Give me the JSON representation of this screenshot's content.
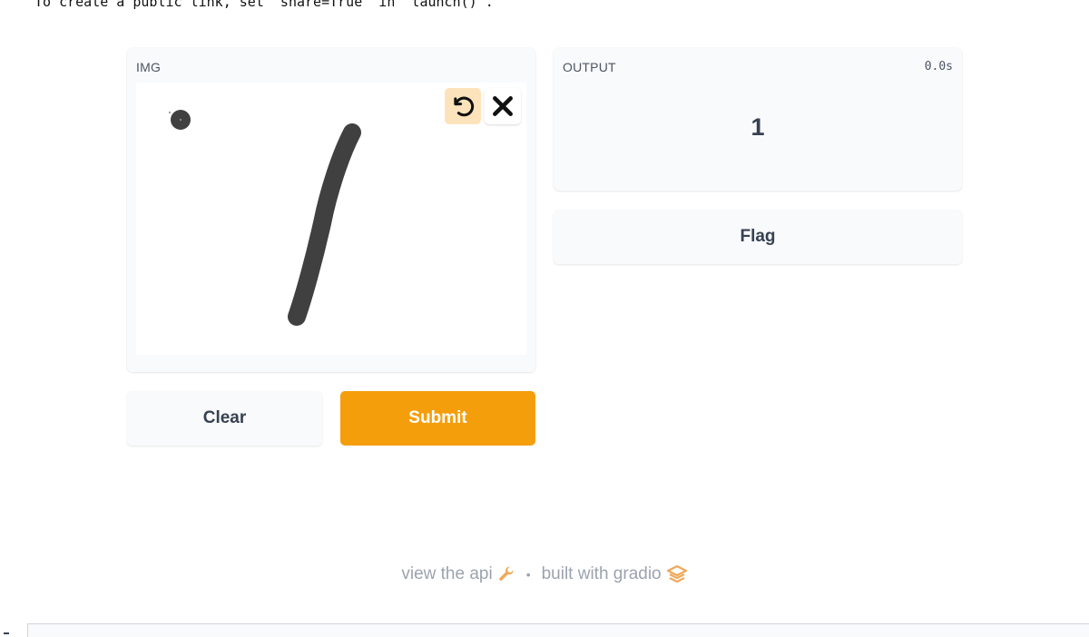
{
  "console": {
    "message": "To create a public link, set `share=True` in `launch()`."
  },
  "input_panel": {
    "label": "IMG",
    "tools": {
      "undo_icon": "undo-icon",
      "clear_icon": "close-icon"
    }
  },
  "output_panel": {
    "label": "OUTPUT",
    "time": "0.0s",
    "value": "1"
  },
  "buttons": {
    "flag": "Flag",
    "clear": "Clear",
    "submit": "Submit"
  },
  "footer": {
    "api_link": "view the api",
    "separator": "•",
    "built_with": "built with gradio"
  },
  "colors": {
    "primary": "#f59e0b",
    "undo_bg": "#fde3bb",
    "stroke": "#404040",
    "muted_text": "#9ca3af",
    "footer_icon": "#f0a85a"
  }
}
